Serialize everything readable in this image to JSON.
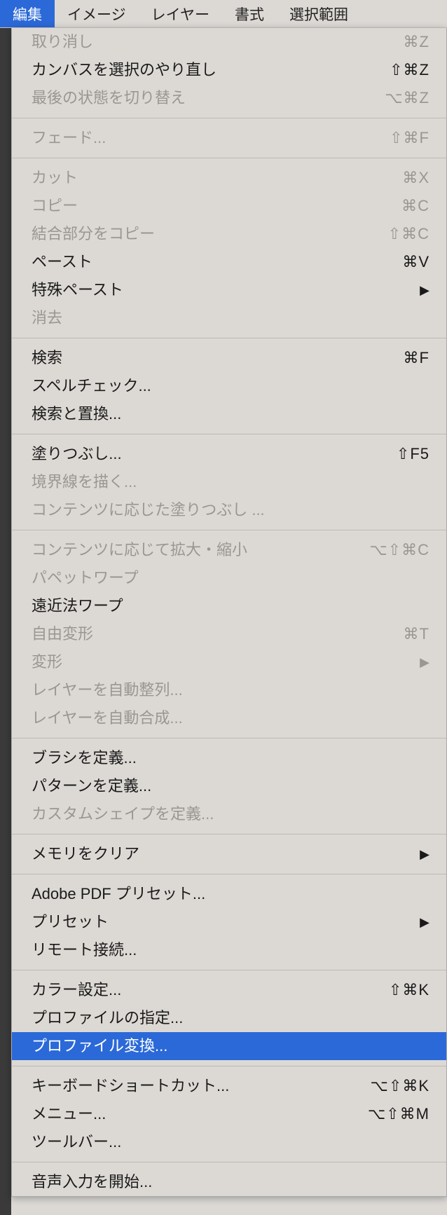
{
  "menubar": {
    "items": [
      {
        "label": "編集",
        "active": true
      },
      {
        "label": "イメージ"
      },
      {
        "label": "レイヤー"
      },
      {
        "label": "書式"
      },
      {
        "label": "選択範囲"
      }
    ]
  },
  "menu": {
    "groups": [
      [
        {
          "label": "取り消し",
          "shortcut": "⌘Z",
          "disabled": true
        },
        {
          "label": "カンバスを選択のやり直し",
          "shortcut": "⇧⌘Z"
        },
        {
          "label": "最後の状態を切り替え",
          "shortcut": "⌥⌘Z",
          "disabled": true
        }
      ],
      [
        {
          "label": "フェード...",
          "shortcut": "⇧⌘F",
          "disabled": true
        }
      ],
      [
        {
          "label": "カット",
          "shortcut": "⌘X",
          "disabled": true
        },
        {
          "label": "コピー",
          "shortcut": "⌘C",
          "disabled": true
        },
        {
          "label": "結合部分をコピー",
          "shortcut": "⇧⌘C",
          "disabled": true
        },
        {
          "label": "ペースト",
          "shortcut": "⌘V"
        },
        {
          "label": "特殊ペースト",
          "submenu": true
        },
        {
          "label": "消去",
          "disabled": true
        }
      ],
      [
        {
          "label": "検索",
          "shortcut": "⌘F"
        },
        {
          "label": "スペルチェック..."
        },
        {
          "label": "検索と置換..."
        }
      ],
      [
        {
          "label": "塗りつぶし...",
          "shortcut": "⇧F5"
        },
        {
          "label": "境界線を描く...",
          "disabled": true
        },
        {
          "label": "コンテンツに応じた塗りつぶし ...",
          "disabled": true
        }
      ],
      [
        {
          "label": "コンテンツに応じて拡大・縮小",
          "shortcut": "⌥⇧⌘C",
          "disabled": true
        },
        {
          "label": "パペットワープ",
          "disabled": true
        },
        {
          "label": "遠近法ワープ"
        },
        {
          "label": "自由変形",
          "shortcut": "⌘T",
          "disabled": true
        },
        {
          "label": "変形",
          "submenu": true,
          "disabled": true
        },
        {
          "label": "レイヤーを自動整列...",
          "disabled": true
        },
        {
          "label": "レイヤーを自動合成...",
          "disabled": true
        }
      ],
      [
        {
          "label": "ブラシを定義..."
        },
        {
          "label": "パターンを定義..."
        },
        {
          "label": "カスタムシェイプを定義...",
          "disabled": true
        }
      ],
      [
        {
          "label": "メモリをクリア",
          "submenu": true
        }
      ],
      [
        {
          "label": "Adobe PDF プリセット..."
        },
        {
          "label": "プリセット",
          "submenu": true
        },
        {
          "label": "リモート接続..."
        }
      ],
      [
        {
          "label": "カラー設定...",
          "shortcut": "⇧⌘K"
        },
        {
          "label": "プロファイルの指定..."
        },
        {
          "label": "プロファイル変換...",
          "highlighted": true
        }
      ],
      [
        {
          "label": "キーボードショートカット...",
          "shortcut": "⌥⇧⌘K"
        },
        {
          "label": "メニュー...",
          "shortcut": "⌥⇧⌘M"
        },
        {
          "label": "ツールバー..."
        }
      ],
      [
        {
          "label": "音声入力を開始..."
        }
      ]
    ]
  }
}
